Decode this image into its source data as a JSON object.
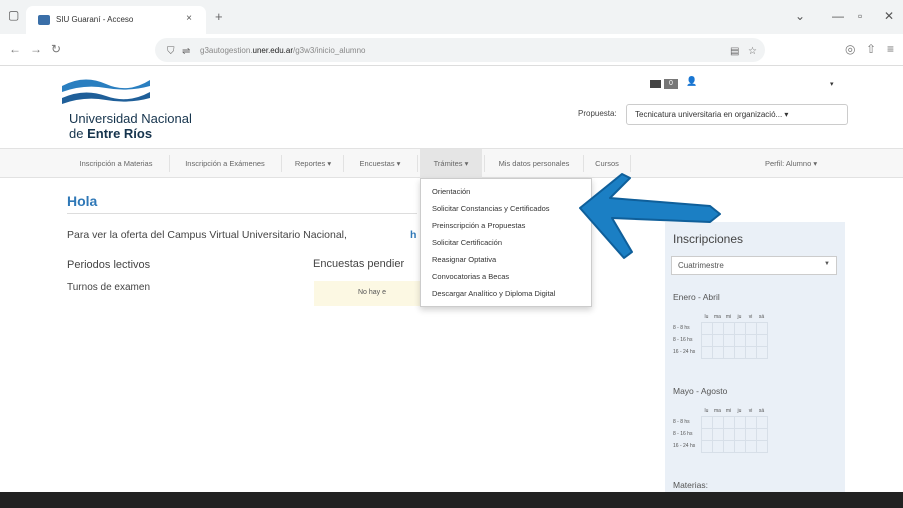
{
  "browser": {
    "tab_title": "SIU Guaraní - Acceso",
    "tab_close": "×",
    "new_tab": "+",
    "url_prefix": "g3autogestion.",
    "url_domain": "uner.edu.ar",
    "url_path": "/g3w3/inicio_alumno",
    "window_min": "—",
    "window_max": "▫",
    "window_close": "✕"
  },
  "header": {
    "logo_line1": "Universidad Nacional",
    "logo_line2_plain": "de ",
    "logo_line2_bold": "Entre Ríos",
    "message_count": "0",
    "propuesta_label": "Propuesta:",
    "propuesta_value": "Tecnicatura universitaria en organizació...",
    "select_caret": "▾"
  },
  "menu": {
    "items": [
      "Inscripción a Materias",
      "Inscripción a Exámenes",
      "Reportes",
      "Encuestas",
      "Trámites",
      "Mis datos personales",
      "Cursos"
    ],
    "caret": "▾",
    "profile": "Perfil: Alumno"
  },
  "dropdown": {
    "items": [
      "Orientación",
      "Solicitar Constancias y Certificados",
      "Preinscripción a Propuestas",
      "Solicitar Certificación",
      "Reasignar Optativa",
      "Convocatorias a Becas",
      "Descargar Analítico y Diploma Digital"
    ]
  },
  "main": {
    "greeting": "Hola",
    "intro": "Para ver la oferta del Campus Virtual Universitario Nacional,",
    "intro_link": "h",
    "periodos": "Periodos lectivos",
    "turnos": "Turnos de examen",
    "encuestas": "Encuestas pendier",
    "no_hay": "No hay e"
  },
  "inscripciones": {
    "title": "Inscripciones",
    "select_value": "Cuatrimestre",
    "period1": "Enero - Abril",
    "period2": "Mayo - Agosto",
    "days": [
      "lu",
      "ma",
      "mi",
      "ju",
      "vi",
      "sá"
    ],
    "rows": [
      "8 - 8 hs",
      "8 - 16 hs",
      "16 - 24 hs"
    ],
    "materias": "Materias:"
  },
  "colors": {
    "accent": "#2f78b7",
    "arrow": "#1b7fc4",
    "brand": "#16344d",
    "footer": "#222222"
  }
}
